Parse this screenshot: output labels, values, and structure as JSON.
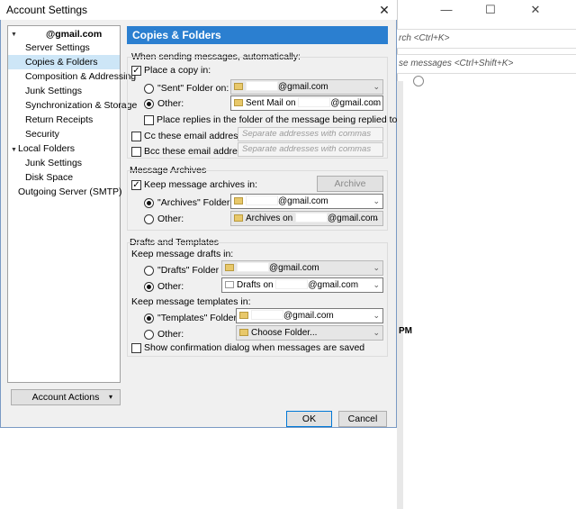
{
  "dialog": {
    "title": "Account Settings",
    "close_glyph": "✕"
  },
  "background": {
    "window_controls": [
      "—",
      "☐",
      "✕"
    ],
    "search_hint": "rch <Ctrl+K>",
    "filter_hint": "se messages <Ctrl+Shift+K>",
    "time_fragment": "PM"
  },
  "tree": {
    "account": "@gmail.com",
    "items": [
      "Server Settings",
      "Copies & Folders",
      "Composition & Addressing",
      "Junk Settings",
      "Synchronization & Storage",
      "Return Receipts",
      "Security"
    ],
    "local_folders": "Local Folders",
    "local_items": [
      "Junk Settings",
      "Disk Space"
    ],
    "outgoing": "Outgoing Server (SMTP)"
  },
  "account_actions": "Account Actions",
  "panel": {
    "header": "Copies & Folders",
    "sending_label": "When sending messages, automatically:",
    "place_copy": "Place a copy in:",
    "sent_folder_on": "\"Sent\" Folder on:",
    "sent_combo": "@gmail.com",
    "other": "Other:",
    "sent_other_combo": "Sent Mail on",
    "sent_other_combo_suffix": "@gmail.com",
    "place_replies": "Place replies in the folder of the message being replied to",
    "cc_label": "Cc these email addresses:",
    "bcc_label": "Bcc these email addresses:",
    "cc_placeholder": "Separate addresses with commas",
    "bcc_placeholder": "Separate addresses with commas",
    "archives_title": "Message Archives",
    "keep_archives": "Keep message archives in:",
    "archive_options": "Archive options...",
    "archives_folder_on": "\"Archives\" Folder on:",
    "archives_combo_suffix": "@gmail.com",
    "archives_other_combo": "Archives on",
    "archives_other_suffix": "@gmail.com",
    "drafts_title": "Drafts and Templates",
    "keep_drafts": "Keep message drafts in:",
    "drafts_folder_on": "\"Drafts\" Folder on:",
    "drafts_combo_suffix": "@gmail.com",
    "drafts_other_combo": "Drafts on",
    "drafts_other_suffix": "@gmail.com",
    "keep_templates": "Keep message templates in:",
    "templates_folder_on": "\"Templates\" Folder on:",
    "templates_combo_suffix": "@gmail.com",
    "templates_other_combo": "Choose Folder...",
    "show_confirmation": "Show confirmation dialog when messages are saved"
  },
  "buttons": {
    "ok": "OK",
    "cancel": "Cancel"
  },
  "colors": {
    "header_bg": "#2b7fd0",
    "selection_bg": "#cde6f7"
  }
}
